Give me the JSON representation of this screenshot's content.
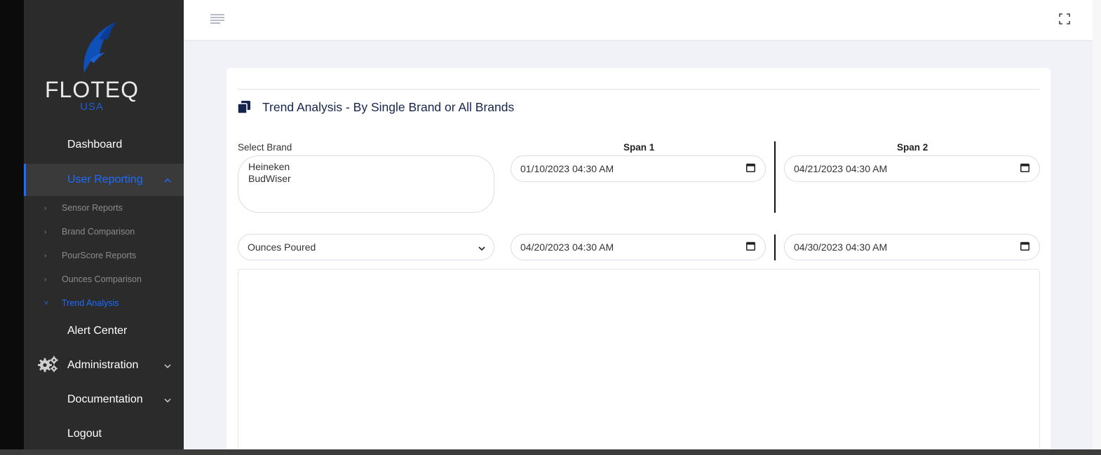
{
  "brand": {
    "logo_text": "FLOTEQ",
    "logo_sub": "USA",
    "accent": "#1e6bff",
    "logo_blue": "#0f4fb8"
  },
  "sidebar": {
    "items": [
      {
        "label": "Dashboard"
      },
      {
        "label": "User Reporting",
        "active": true
      },
      {
        "label": "Alert Center"
      },
      {
        "label": "Administration"
      },
      {
        "label": "Documentation"
      },
      {
        "label": "Logout"
      }
    ],
    "subitems": [
      {
        "label": "Sensor Reports"
      },
      {
        "label": "Brand Comparison"
      },
      {
        "label": "PourScore Reports"
      },
      {
        "label": "Ounces Comparison"
      },
      {
        "label": "Trend Analysis",
        "active": true
      }
    ]
  },
  "topbar": {
    "menu_icon": "menu-lines-icon",
    "fullscreen_icon": "fullscreen-icon"
  },
  "card": {
    "title": "Trend Analysis - By Single Brand or All Brands",
    "select_brand_label": "Select Brand",
    "brands": [
      "Heineken",
      "BudWiser"
    ],
    "span1_label": "Span 1",
    "span2_label": "Span 2",
    "span1_start": "01/10/2023 04:30 AM",
    "span1_end": "04/20/2023 04:30 AM",
    "span2_start": "04/21/2023 04:30 AM",
    "span2_end": "04/30/2023 04:30 AM",
    "metric_selected": "Ounces Poured"
  }
}
